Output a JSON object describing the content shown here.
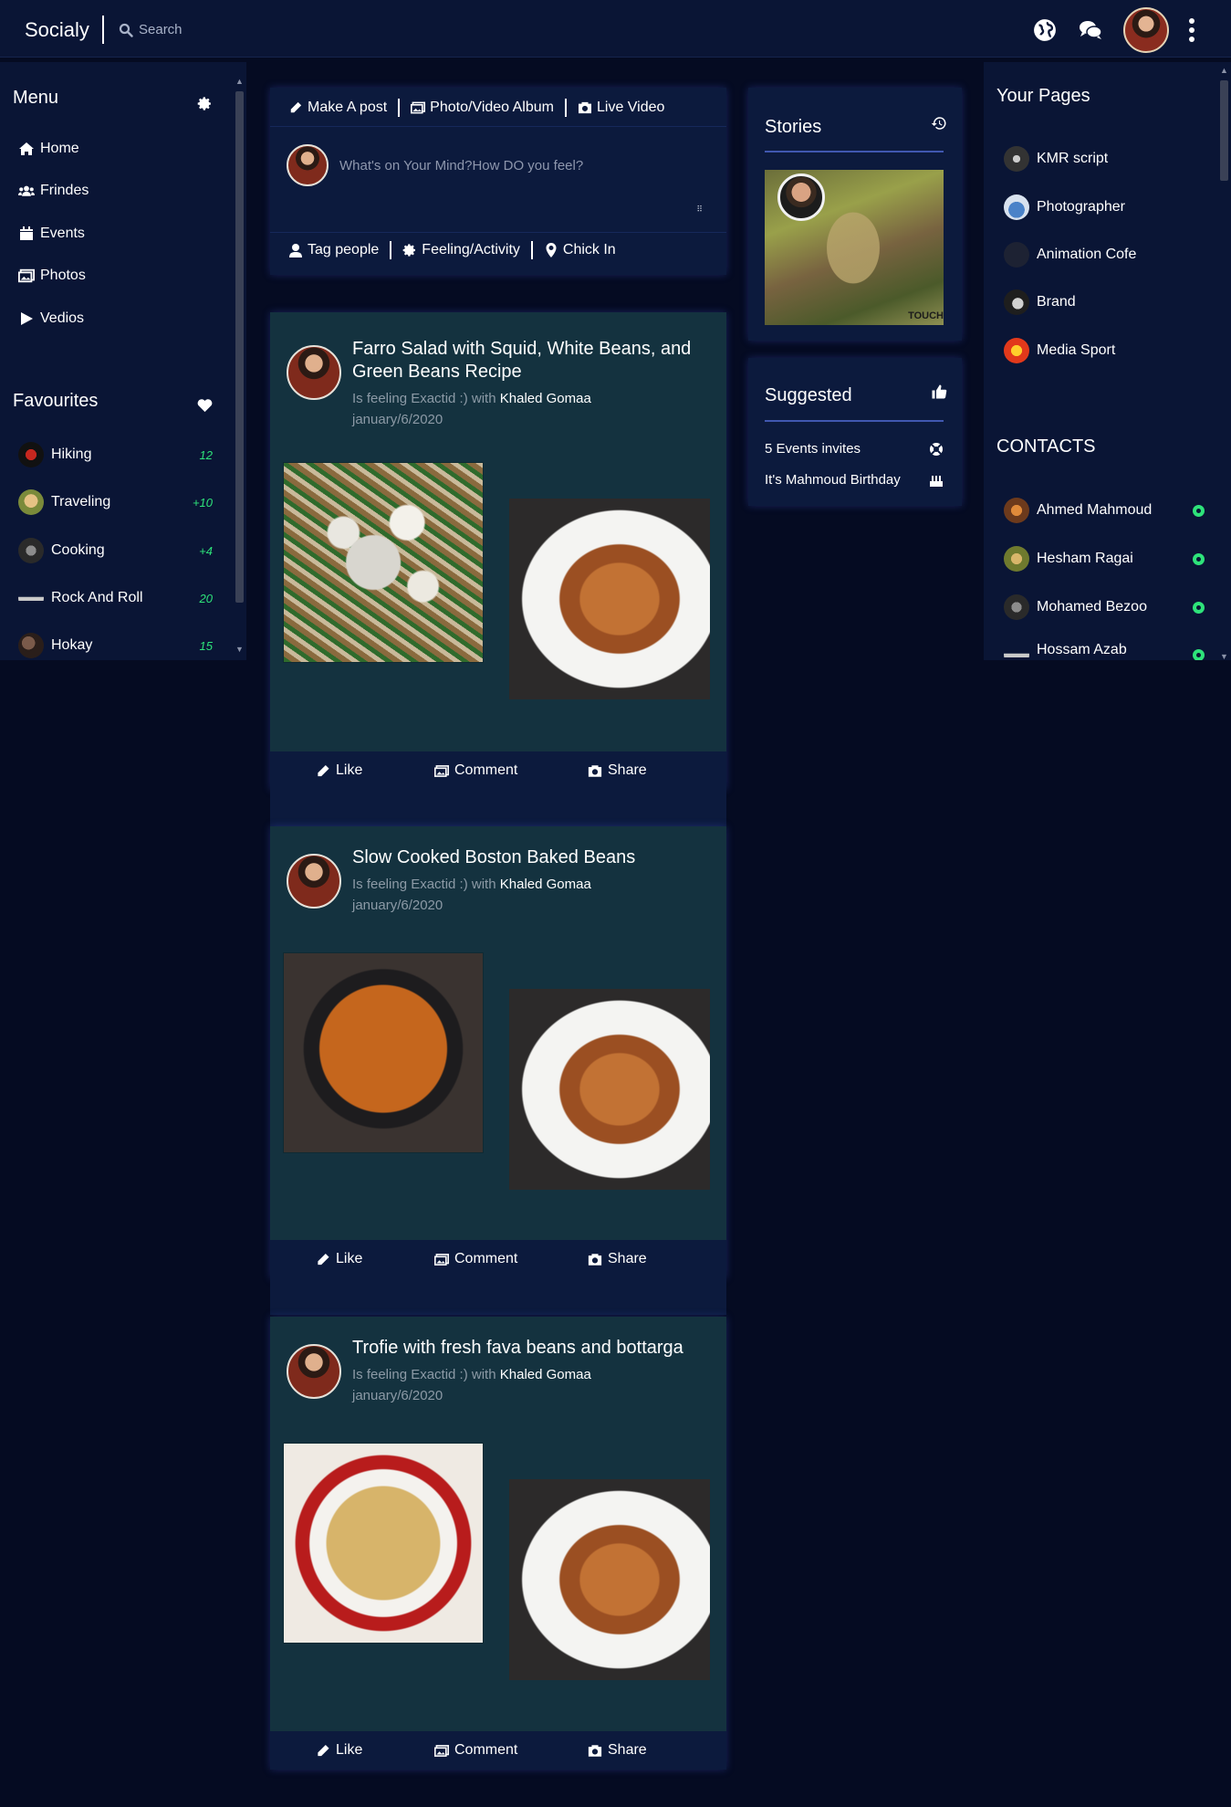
{
  "app": {
    "name": "Socialy"
  },
  "search": {
    "placeholder": "Search"
  },
  "left_menu": {
    "title": "Menu",
    "items": [
      {
        "label": "Home",
        "icon": "home-icon"
      },
      {
        "label": "Frindes",
        "icon": "users-icon"
      },
      {
        "label": "Events",
        "icon": "calendar-icon"
      },
      {
        "label": "Photos",
        "icon": "photos-icon"
      },
      {
        "label": "Vedios",
        "icon": "play-icon"
      }
    ]
  },
  "favourites": {
    "title": "Favourites",
    "items": [
      {
        "label": "Hiking",
        "count": "12"
      },
      {
        "label": "Traveling",
        "count": "+10"
      },
      {
        "label": "Cooking",
        "count": "+4"
      },
      {
        "label": "Rock And Roll",
        "count": "20"
      },
      {
        "label": "Hokay",
        "count": "15"
      }
    ]
  },
  "composer": {
    "tabs": [
      "Make A post",
      "Photo/Video Album",
      "Live Video"
    ],
    "placeholder": "What's on Your Mind?How DO you feel?",
    "bottom": [
      "Tag people",
      "Feeling/Activity",
      "Chick In"
    ]
  },
  "posts": [
    {
      "title": "Farro Salad with Squid, White Beans, and Green Beans Recipe",
      "feeling": "Is feeling Exactid :) with",
      "with": "Khaled Gomaa",
      "date": "january/6/2020",
      "actions": [
        "Like",
        "Comment",
        "Share"
      ]
    },
    {
      "title": "Slow Cooked Boston Baked Beans",
      "feeling": "Is feeling Exactid :) with",
      "with": "Khaled Gomaa",
      "date": "january/6/2020",
      "actions": [
        "Like",
        "Comment",
        "Share"
      ]
    },
    {
      "title": "Trofie with fresh fava beans and bottarga",
      "feeling": "Is feeling Exactid :) with",
      "with": "Khaled Gomaa",
      "date": "january/6/2020",
      "actions": [
        "Like",
        "Comment",
        "Share"
      ]
    }
  ],
  "stories": {
    "title": "Stories",
    "story_text": "TOUCH"
  },
  "suggested": {
    "title": "Suggested",
    "items": [
      {
        "label": "5 Events invites",
        "icon": "life-ring-icon"
      },
      {
        "label": "It's Mahmoud Birthday",
        "icon": "cake-icon"
      }
    ]
  },
  "your_pages": {
    "title": "Your Pages",
    "items": [
      "KMR script",
      "Photographer",
      "Animation Cofe",
      "Brand",
      "Media Sport"
    ]
  },
  "contacts": {
    "title": "CONTACTS",
    "items": [
      "Ahmed Mahmoud",
      "Hesham Ragai",
      "Mohamed Bezoo",
      "Hossam Azab"
    ]
  },
  "colors": {
    "background": "#050b22",
    "panel": "#0c1a3d",
    "post": "#14323f",
    "accent_line": "#4057b0",
    "online": "#2ee37a"
  }
}
